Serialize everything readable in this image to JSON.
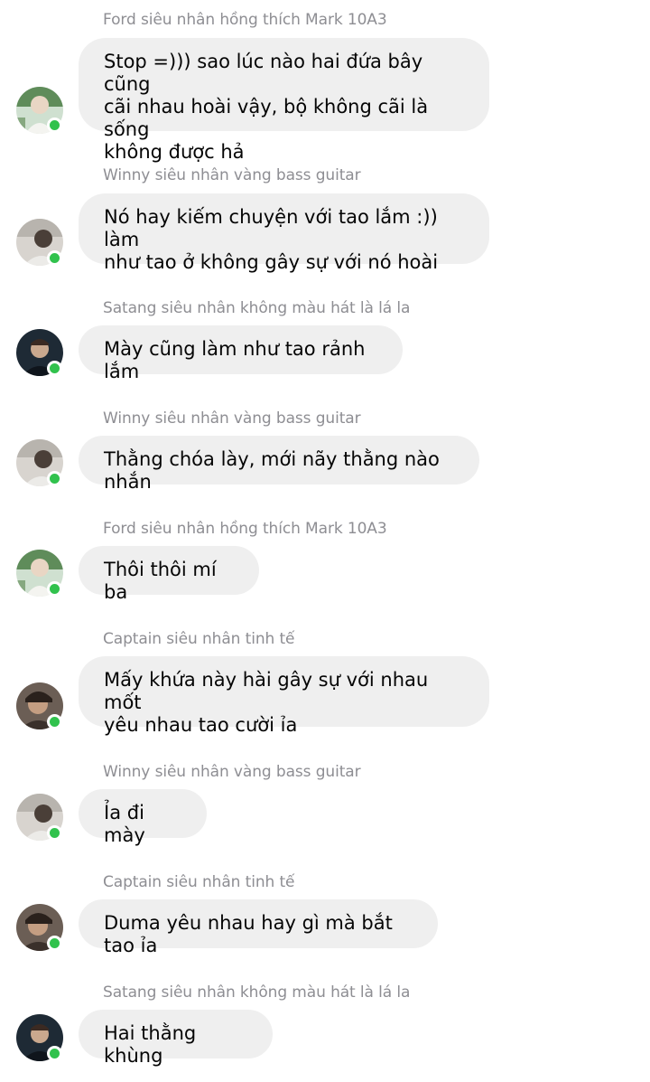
{
  "colors": {
    "bubble_bg": "#efefef",
    "sender_text": "#8e8e93",
    "online_dot": "#31c24d"
  },
  "messages": [
    {
      "sender": "Ford siêu nhân hồng thích Mark 10A3",
      "text": "Stop =))) sao lúc nào hai đứa bây cũng\ncãi nhau hoài vậy, bộ không cãi là sống\nkhông được hả",
      "avatar_icon": "ford-avatar-icon",
      "online": true
    },
    {
      "sender": "Winny siêu nhân vàng bass guitar",
      "text": "Nó hay kiếm chuyện với tao lắm :)) làm\nnhư tao ở không gây sự với nó hoài",
      "avatar_icon": "winny-avatar-icon",
      "online": true
    },
    {
      "sender": "Satang siêu nhân không màu hát là lá la",
      "text": "Mày cũng làm như tao rảnh lắm",
      "avatar_icon": "satang-avatar-icon",
      "online": true
    },
    {
      "sender": "Winny siêu nhân vàng bass guitar",
      "text": "Thằng chóa lày, mới nãy thằng nào nhắn",
      "avatar_icon": "winny-avatar-icon",
      "online": true
    },
    {
      "sender": "Ford siêu nhân hồng thích Mark 10A3",
      "text": "Thôi thôi mí ba",
      "avatar_icon": "ford-avatar-icon",
      "online": true
    },
    {
      "sender": "Captain siêu nhân tinh tế",
      "text": "Mấy khứa này hài gây sự với nhau mốt\nyêu nhau tao cười ỉa",
      "avatar_icon": "captain-avatar-icon",
      "online": true
    },
    {
      "sender": "Winny siêu nhân vàng bass guitar",
      "text": "Ỉa đi mày",
      "avatar_icon": "winny-avatar-icon",
      "online": true
    },
    {
      "sender": "Captain siêu nhân tinh tế",
      "text": "Duma yêu nhau hay gì mà bắt tao ỉa",
      "avatar_icon": "captain-avatar-icon",
      "online": true
    },
    {
      "sender": "Satang siêu nhân không màu hát là lá la",
      "text": "Hai thằng khùng",
      "avatar_icon": "satang-avatar-icon",
      "online": true
    }
  ]
}
